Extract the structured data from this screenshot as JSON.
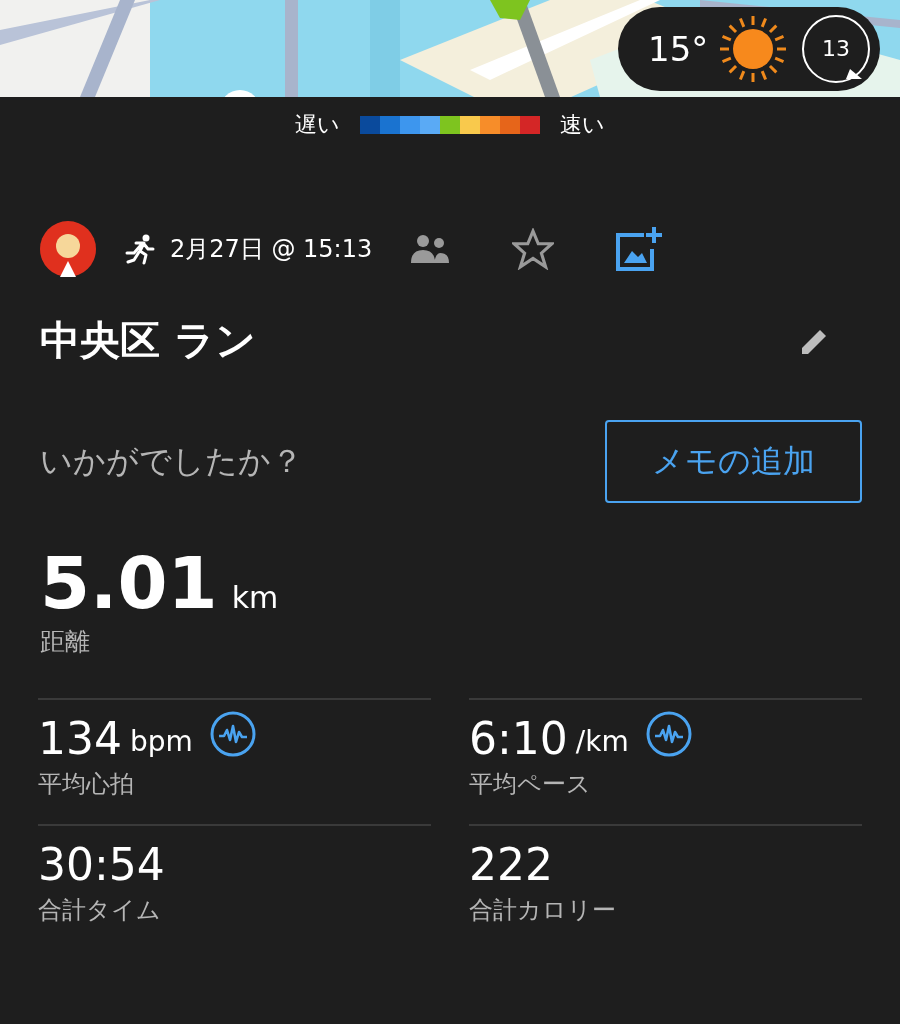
{
  "weather": {
    "temperature": "15°",
    "wind_speed": "13"
  },
  "legend": {
    "slow_label": "遅い",
    "fast_label": "速い",
    "swatches": [
      {
        "color": "#0a4a9c"
      },
      {
        "color": "#1a73d0"
      },
      {
        "color": "#3d96ee"
      },
      {
        "color": "#5aaaf5"
      },
      {
        "color": "#7ec41f"
      },
      {
        "color": "#f9c94c"
      },
      {
        "color": "#f78d29"
      },
      {
        "color": "#e6651a"
      },
      {
        "color": "#d42626"
      }
    ]
  },
  "activity": {
    "date": "2月27日 @ 15:13",
    "favorite": false,
    "title": "中央区 ラン",
    "prompt": "いかがでしたか？",
    "note_button": "メモの追加"
  },
  "distance": {
    "value": "5.01",
    "unit": "km",
    "label": "距離"
  },
  "stats": [
    {
      "value": "134",
      "unit": "bpm",
      "label": "平均心拍",
      "chart_icon": true
    },
    {
      "value": "6:10",
      "unit": "/km",
      "label": "平均ペース",
      "chart_icon": true
    },
    {
      "value": "30:54",
      "label": "合計タイム",
      "chart_icon": false
    },
    {
      "value": "222",
      "label": "合計カロリー",
      "chart_icon": false
    }
  ]
}
